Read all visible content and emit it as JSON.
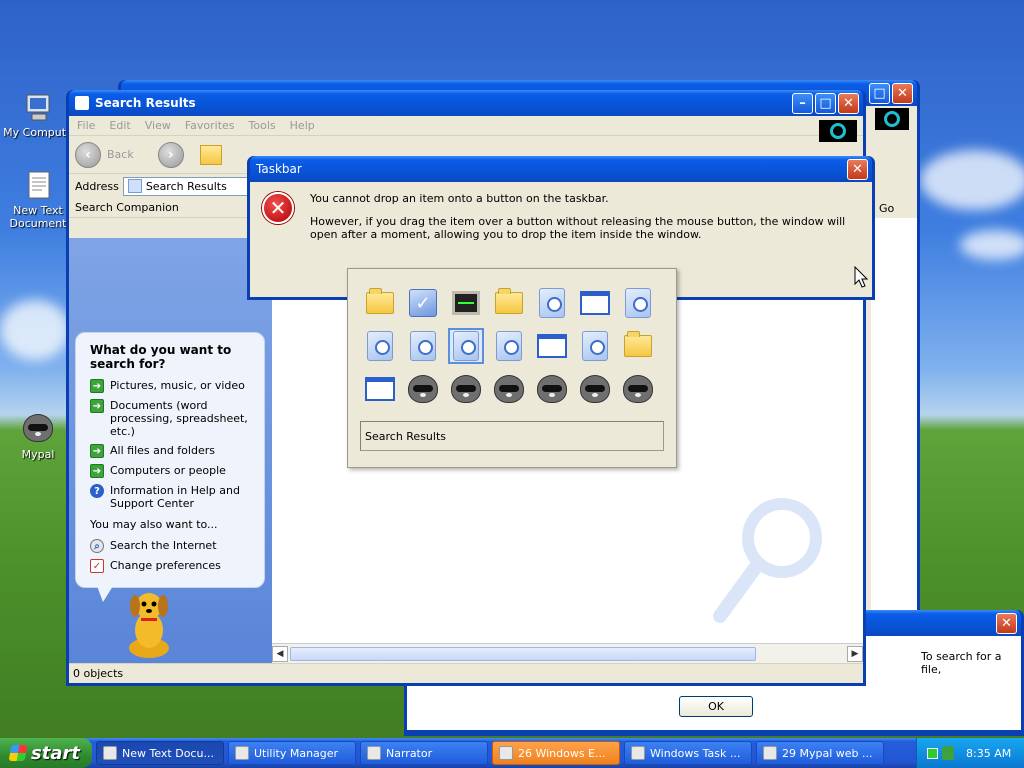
{
  "desktop": {
    "icons": [
      {
        "label": "My Compute"
      },
      {
        "label": "New Text Document"
      },
      {
        "label": "Mypal"
      }
    ]
  },
  "search_window": {
    "title": "Search Results",
    "menu": [
      "File",
      "Edit",
      "View",
      "Favorites",
      "Tools",
      "Help"
    ],
    "toolbar": {
      "back": "Back"
    },
    "address_label": "Address",
    "address_value": "Search Results",
    "pane_title": "Search Companion",
    "companion": {
      "heading": "What do you want to search for?",
      "options": [
        {
          "label": "Pictures, music, or video"
        },
        {
          "label": "Documents (word processing, spreadsheet, etc.)"
        },
        {
          "label": "All files and folders"
        },
        {
          "label": "Computers or people"
        },
        {
          "label": "Information in Help and Support Center"
        }
      ],
      "also_heading": "You may also want to...",
      "also_options": [
        {
          "label": "Search the Internet"
        },
        {
          "label": "Change preferences"
        }
      ]
    },
    "status": "0 objects"
  },
  "back_window": {
    "go_label": "Go"
  },
  "hint_window": {
    "text": "To search for a file,",
    "ok_label": "OK"
  },
  "dialog": {
    "title": "Taskbar",
    "message_1": "You cannot drop an item onto a button on the taskbar.",
    "message_2": "However, if you drag the item over a button without releasing the mouse button, the window will open after a moment, allowing you to drop the item inside the window."
  },
  "switcher": {
    "rows": [
      [
        "folder",
        "system",
        "monitor",
        "folder",
        "search",
        "window",
        "search"
      ],
      [
        "search",
        "search",
        "search",
        "search",
        "window",
        "search",
        "folder"
      ],
      [
        "window",
        "raccoon",
        "raccoon",
        "raccoon",
        "raccoon",
        "raccoon",
        "raccoon"
      ]
    ],
    "selected": "1-2",
    "current_name": "Search Results"
  },
  "taskbar": {
    "start_label": "start",
    "items": [
      {
        "label": "New Text Docu...",
        "state": "active"
      },
      {
        "label": "Utility Manager",
        "state": "normal"
      },
      {
        "label": "Narrator",
        "state": "normal"
      },
      {
        "label": "26 Windows E...",
        "state": "flash"
      },
      {
        "label": "Windows Task ...",
        "state": "normal"
      },
      {
        "label": "29 Mypal web ...",
        "state": "normal"
      }
    ],
    "clock": "8:35 AM"
  },
  "colors": {
    "title_blue": "#0853d6",
    "close_red": "#c3381b",
    "taskbar_blue": "#245edb",
    "start_green": "#2f8b2f"
  }
}
